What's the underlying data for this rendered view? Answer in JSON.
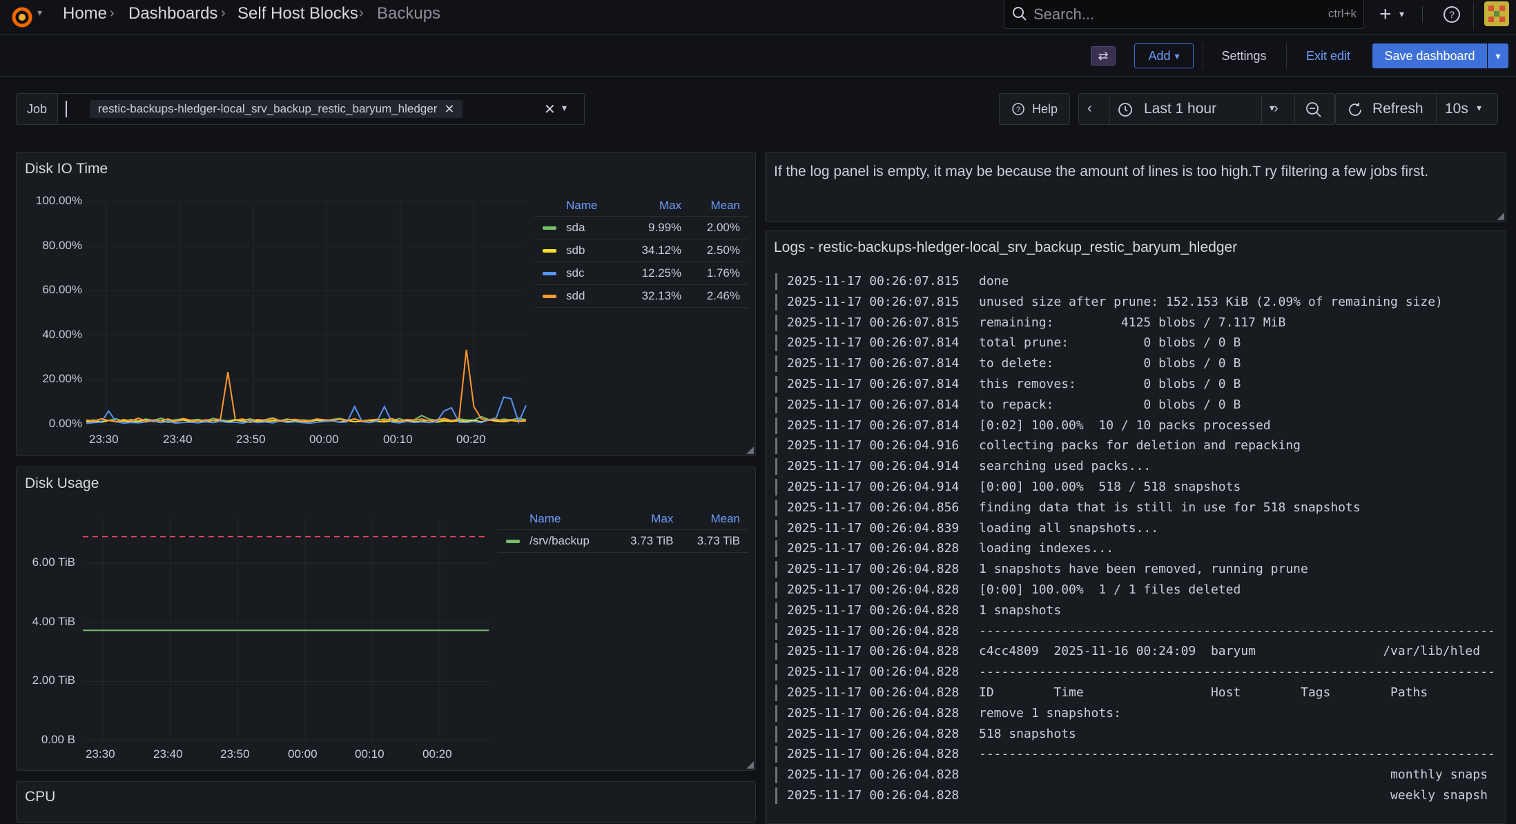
{
  "breadcrumb": {
    "items": [
      "Home",
      "Dashboards",
      "Self Host Blocks",
      "Backups"
    ]
  },
  "search": {
    "placeholder": "Search...",
    "shortcut": "ctrl+k"
  },
  "toolbar": {
    "add": "Add",
    "settings": "Settings",
    "exit_edit": "Exit edit",
    "save": "Save dashboard"
  },
  "variables": {
    "job_label": "Job",
    "job_value": "restic-backups-hledger-local_srv_backup_restic_baryum_hledger"
  },
  "time": {
    "help": "Help",
    "range": "Last 1 hour",
    "refresh": "Refresh",
    "interval": "10s"
  },
  "colors": {
    "accent": "#3d71d9",
    "sda": "#73bf69",
    "sdb": "#fade2a",
    "sdc": "#5794f2",
    "sdd": "#ff9830",
    "threshold": "#f2495c"
  },
  "disk_io": {
    "title": "Disk IO Time",
    "legend_headers": {
      "name": "Name",
      "max": "Max",
      "mean": "Mean"
    },
    "legend": [
      {
        "name": "sda",
        "max": "9.99%",
        "mean": "2.00%"
      },
      {
        "name": "sdb",
        "max": "34.12%",
        "mean": "2.50%"
      },
      {
        "name": "sdc",
        "max": "12.25%",
        "mean": "1.76%"
      },
      {
        "name": "sdd",
        "max": "32.13%",
        "mean": "2.46%"
      }
    ],
    "y_ticks": [
      "100.00%",
      "80.00%",
      "60.00%",
      "40.00%",
      "20.00%",
      "0.00%"
    ],
    "x_ticks": [
      "23:30",
      "23:40",
      "23:50",
      "00:00",
      "00:10",
      "00:20"
    ]
  },
  "disk_usage": {
    "title": "Disk Usage",
    "legend_headers": {
      "name": "Name",
      "max": "Max",
      "mean": "Mean"
    },
    "legend": [
      {
        "name": "/srv/backup",
        "max": "3.73 TiB",
        "mean": "3.73 TiB"
      }
    ],
    "y_ticks": [
      "6.00 TiB",
      "4.00 TiB",
      "2.00 TiB",
      "0.00 B"
    ],
    "x_ticks": [
      "23:30",
      "23:40",
      "23:50",
      "00:00",
      "00:10",
      "00:20"
    ]
  },
  "cpu": {
    "title": "CPU"
  },
  "note": {
    "text": "If the log panel is empty, it may be because the amount of lines is too high.T ry filtering a few jobs first."
  },
  "logs": {
    "title": "Logs - restic-backups-hledger-local_srv_backup_restic_baryum_hledger",
    "lines": [
      {
        "ts": "2025-11-17 00:26:07.815",
        "msg": "done"
      },
      {
        "ts": "2025-11-17 00:26:07.815",
        "msg": "unused size after prune: 152.153 KiB (2.09% of remaining size)"
      },
      {
        "ts": "2025-11-17 00:26:07.815",
        "msg": "remaining:         4125 blobs / 7.117 MiB"
      },
      {
        "ts": "2025-11-17 00:26:07.814",
        "msg": "total prune:          0 blobs / 0 B"
      },
      {
        "ts": "2025-11-17 00:26:07.814",
        "msg": "to delete:            0 blobs / 0 B"
      },
      {
        "ts": "2025-11-17 00:26:07.814",
        "msg": "this removes:         0 blobs / 0 B"
      },
      {
        "ts": "2025-11-17 00:26:07.814",
        "msg": "to repack:            0 blobs / 0 B"
      },
      {
        "ts": "2025-11-17 00:26:07.814",
        "msg": "[0:02] 100.00%  10 / 10 packs processed"
      },
      {
        "ts": "2025-11-17 00:26:04.916",
        "msg": "collecting packs for deletion and repacking"
      },
      {
        "ts": "2025-11-17 00:26:04.914",
        "msg": "searching used packs..."
      },
      {
        "ts": "2025-11-17 00:26:04.914",
        "msg": "[0:00] 100.00%  518 / 518 snapshots"
      },
      {
        "ts": "2025-11-17 00:26:04.856",
        "msg": "finding data that is still in use for 518 snapshots"
      },
      {
        "ts": "2025-11-17 00:26:04.839",
        "msg": "loading all snapshots..."
      },
      {
        "ts": "2025-11-17 00:26:04.828",
        "msg": "loading indexes..."
      },
      {
        "ts": "2025-11-17 00:26:04.828",
        "msg": "1 snapshots have been removed, running prune"
      },
      {
        "ts": "2025-11-17 00:26:04.828",
        "msg": "[0:00] 100.00%  1 / 1 files deleted"
      },
      {
        "ts": "2025-11-17 00:26:04.828",
        "msg": "1 snapshots"
      },
      {
        "ts": "2025-11-17 00:26:04.828",
        "msg": "---------------------------------------------------------------------"
      },
      {
        "ts": "2025-11-17 00:26:04.828",
        "msg": "c4cc4809  2025-11-16 00:24:09  baryum                 /var/lib/hled"
      },
      {
        "ts": "2025-11-17 00:26:04.828",
        "msg": "---------------------------------------------------------------------"
      },
      {
        "ts": "2025-11-17 00:26:04.828",
        "msg": "ID        Time                 Host        Tags        Paths"
      },
      {
        "ts": "2025-11-17 00:26:04.828",
        "msg": "remove 1 snapshots:"
      },
      {
        "ts": "2025-11-17 00:26:04.828",
        "msg": "518 snapshots"
      },
      {
        "ts": "2025-11-17 00:26:04.828",
        "msg": "---------------------------------------------------------------------"
      },
      {
        "ts": "2025-11-17 00:26:04.828",
        "msg": "                                                       monthly snaps"
      },
      {
        "ts": "2025-11-17 00:26:04.828",
        "msg": "                                                       weekly snapsh"
      }
    ]
  },
  "chart_data": [
    {
      "type": "line",
      "title": "Disk IO Time",
      "ylim": [
        0,
        100
      ],
      "x": [
        0,
        1,
        2,
        3,
        4,
        5,
        6,
        7,
        8,
        9,
        10,
        11,
        12,
        13,
        14,
        15,
        16,
        17,
        18,
        19,
        20,
        21,
        22,
        23,
        24,
        25,
        26,
        27,
        28,
        29,
        30,
        31,
        32,
        33,
        34,
        35,
        36,
        37,
        38,
        39,
        40,
        41,
        42,
        43,
        44,
        45,
        46,
        47,
        48,
        49,
        50,
        51,
        52,
        53,
        54,
        55,
        56,
        57,
        58,
        59
      ],
      "x_tick_labels": [
        "23:30",
        "23:40",
        "23:50",
        "00:00",
        "00:10",
        "00:20"
      ],
      "series": [
        {
          "name": "sda",
          "values": [
            1.5,
            2,
            1.2,
            1.8,
            2.5,
            1.4,
            2.2,
            1.6,
            2.4,
            1.8,
            2.8,
            1.7,
            2.1,
            2.6,
            1.9,
            2.3,
            1.5,
            2.7,
            2.0,
            1.6,
            2.2,
            1.8,
            2.5,
            1.4,
            2.1,
            2.9,
            1.7,
            2.4,
            1.6,
            2.0,
            1.8,
            2.5,
            1.5,
            2.2,
            2.7,
            1.9,
            2.3,
            1.6,
            2.0,
            1.8,
            2.4,
            1.7,
            2.6,
            1.5,
            2.1,
            4.0,
            2.4,
            1.8,
            2.2,
            1.6,
            2.5,
            2.0,
            1.9,
            3.5,
            2.2,
            1.6,
            2.4,
            2.0,
            2.8,
            2.1
          ]
        },
        {
          "name": "sdb",
          "values": [
            1.2,
            1.5,
            1.0,
            1.8,
            1.3,
            1.6,
            1.1,
            1.4,
            1.9,
            1.2,
            1.7,
            1.0,
            1.5,
            2.0,
            1.3,
            1.6,
            1.1,
            1.8,
            1.4,
            1.2,
            1.9,
            1.5,
            1.0,
            1.7,
            1.3,
            1.6,
            1.8,
            1.2,
            1.5,
            1.1,
            1.4,
            1.9,
            1.3,
            1.6,
            1.0,
            1.8,
            1.2,
            1.5,
            1.7,
            1.3,
            1.1,
            1.6,
            1.4,
            1.9,
            1.2,
            1.5,
            1.8,
            1.0,
            1.6,
            1.3,
            1.7,
            1.4,
            1.9,
            1.1,
            2.0,
            1.5,
            1.2,
            1.8,
            1.4,
            1.6
          ]
        },
        {
          "name": "sdc",
          "values": [
            0.5,
            0.8,
            1.0,
            6.0,
            1.2,
            0.6,
            0.9,
            0.7,
            1.1,
            1.5,
            0.8,
            1.3,
            0.6,
            0.9,
            1.0,
            0.7,
            1.2,
            0.8,
            1.4,
            0.9,
            1.0,
            0.6,
            1.3,
            0.8,
            1.1,
            0.7,
            1.5,
            0.9,
            1.2,
            0.8,
            0.6,
            1.0,
            1.3,
            1.7,
            0.9,
            1.1,
            8.0,
            1.2,
            0.8,
            1.4,
            8.0,
            1.0,
            0.7,
            1.3,
            0.9,
            1.1,
            0.8,
            1.2,
            6.0,
            7.5,
            1.0,
            0.9,
            1.3,
            0.8,
            2.0,
            3.0,
            12.25,
            11.5,
            1.0,
            8.5
          ]
        },
        {
          "name": "sdd",
          "values": [
            2,
            1.5,
            2.5,
            1.8,
            1.2,
            2.2,
            1.6,
            2.8,
            1.4,
            2.0,
            1.7,
            2.4,
            1.3,
            2.6,
            1.9,
            1.5,
            2.1,
            1.8,
            2.3,
            23.5,
            2.0,
            2.4,
            1.7,
            2.2,
            1.9,
            2.6,
            1.5,
            2.0,
            2.3,
            1.8,
            1.6,
            2.4,
            2.1,
            1.9,
            2.2,
            1.7,
            2.5,
            1.4,
            2.0,
            2.3,
            1.8,
            2.6,
            1.5,
            2.2,
            1.9,
            2.4,
            1.6,
            2.0,
            2.7,
            1.8,
            2.2,
            33.5,
            8.0,
            2.5,
            1.9,
            2.3,
            1.7,
            2.1,
            1.6,
            1.9
          ]
        }
      ]
    },
    {
      "type": "line",
      "title": "Disk Usage",
      "ylim": [
        0,
        7.5
      ],
      "x_tick_labels": [
        "23:30",
        "23:40",
        "23:50",
        "00:00",
        "00:10",
        "00:20"
      ],
      "series": [
        {
          "name": "/srv/backup",
          "values": [
            3.73,
            3.73
          ]
        }
      ],
      "threshold": 6.9
    }
  ]
}
